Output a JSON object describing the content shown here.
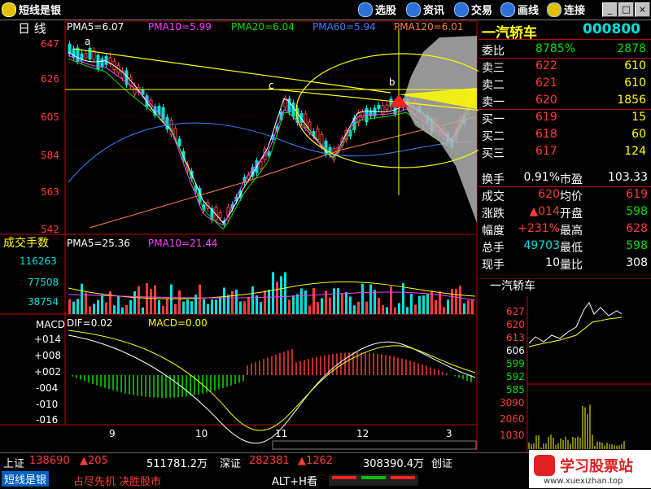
{
  "titlebar": {
    "app_name": "短线是银",
    "buttons": [
      "选股",
      "资讯",
      "交易",
      "画线",
      "连接"
    ],
    "win_min": "_",
    "win_max": "□",
    "win_close": "×"
  },
  "main_chart": {
    "period_label": "日  线",
    "ma_labels": [
      {
        "text": "PMA5=6.07",
        "color": "#ffffff"
      },
      {
        "text": "PMA10=5.99",
        "color": "#ff40ff"
      },
      {
        "text": "PMA20=6.04",
        "color": "#00e000"
      },
      {
        "text": "PMA60=5.94",
        "color": "#4080ff"
      },
      {
        "text": "PMA120=6.01",
        "color": "#ff8040"
      }
    ],
    "y_ticks": [
      "647",
      "626",
      "605",
      "584",
      "563",
      "542"
    ],
    "annotations": [
      "a",
      "b",
      "c"
    ]
  },
  "volume_chart": {
    "title": "成交手数",
    "ma_labels": [
      {
        "text": "PMA5=25.36",
        "color": "#ffffff"
      },
      {
        "text": "PMA10=21.44",
        "color": "#ff40ff"
      }
    ],
    "y_ticks": [
      "116263",
      "77508",
      "38754"
    ]
  },
  "macd_chart": {
    "title": "MACD",
    "labels": [
      {
        "text": "DIF=0.02",
        "color": "#ffffff"
      },
      {
        "text": "MACD=0.00",
        "color": "#ffff00"
      }
    ],
    "y_ticks": [
      "+014",
      "+008",
      "+002",
      "-004",
      "-010",
      "-016"
    ]
  },
  "x_axis": {
    "months": [
      "9",
      "10",
      "11",
      "12",
      "3"
    ]
  },
  "stock": {
    "name": "一汽轿车",
    "code": "000800",
    "quote_rows": [
      {
        "label": "委比",
        "mid": "8785%",
        "right": "2878",
        "mid_color": "#00e000",
        "right_color": "#00e000"
      },
      {
        "label": "卖三",
        "mid": "622",
        "right": "610",
        "mid_color": "#ff3b3b",
        "right_color": "#ffff00"
      },
      {
        "label": "卖二",
        "mid": "621",
        "right": "610",
        "mid_color": "#ff3b3b",
        "right_color": "#ffff00"
      },
      {
        "label": "卖一",
        "mid": "620",
        "right": "1856",
        "mid_color": "#ff3b3b",
        "right_color": "#ffff00"
      },
      {
        "label": "买一",
        "mid": "619",
        "right": "15",
        "mid_color": "#ff3b3b",
        "right_color": "#ffff00"
      },
      {
        "label": "买二",
        "mid": "618",
        "right": "60",
        "mid_color": "#ff3b3b",
        "right_color": "#ffff00"
      },
      {
        "label": "买三",
        "mid": "617",
        "right": "124",
        "mid_color": "#ff3b3b",
        "right_color": "#ffff00"
      }
    ],
    "stats": [
      {
        "l1": "换手",
        "v1": "0.91%",
        "l2": "市盈",
        "v2": "103.33",
        "c1": "#ffffff",
        "c2": "#ffffff"
      },
      {
        "l1": "成交",
        "v1": "620",
        "l2": "均价",
        "v2": "619",
        "c1": "#ff3b3b",
        "c2": "#ff3b3b"
      },
      {
        "l1": "涨跌",
        "v1": "▲014",
        "l2": "开盘",
        "v2": "598",
        "c1": "#ff3b3b",
        "c2": "#00e000"
      },
      {
        "l1": "幅度",
        "v1": "+231%",
        "l2": "最高",
        "v2": "628",
        "c1": "#ff3b3b",
        "c2": "#ff3b3b"
      },
      {
        "l1": "总手",
        "v1": "49703",
        "l2": "最低",
        "v2": "598",
        "c1": "#00e0e0",
        "c2": "#00e000"
      },
      {
        "l1": "现手",
        "v1": "10",
        "l2": "量比",
        "v2": "308",
        "c1": "#ffffff",
        "c2": "#ffffff"
      }
    ]
  },
  "mini_chart": {
    "title": "一汽轿车",
    "price_ticks": [
      "627",
      "620",
      "613",
      "606",
      "599",
      "592",
      "585"
    ],
    "vol_ticks": [
      "3090",
      "2060",
      "1030"
    ]
  },
  "statusbar": {
    "index1_name": "上证",
    "index1_value": "138690",
    "index1_change": "▲205",
    "index1_amount": "511781.2万",
    "index2_name": "深证",
    "index2_value": "282381",
    "index2_change": "▲1262",
    "index2_amount": "308390.4万",
    "index3_name": "创证",
    "slogan_brand": "短线是银",
    "slogan": "占尽先机 决胜股市",
    "shortcut": "ALT+H看"
  },
  "watermark": {
    "brand": "学习股票站",
    "url": "www.xuexizhan.top"
  },
  "colors": {
    "up": "#ff3b3b",
    "down": "#00e0e0",
    "axis": "#ff3b3b",
    "bg": "#000000"
  }
}
